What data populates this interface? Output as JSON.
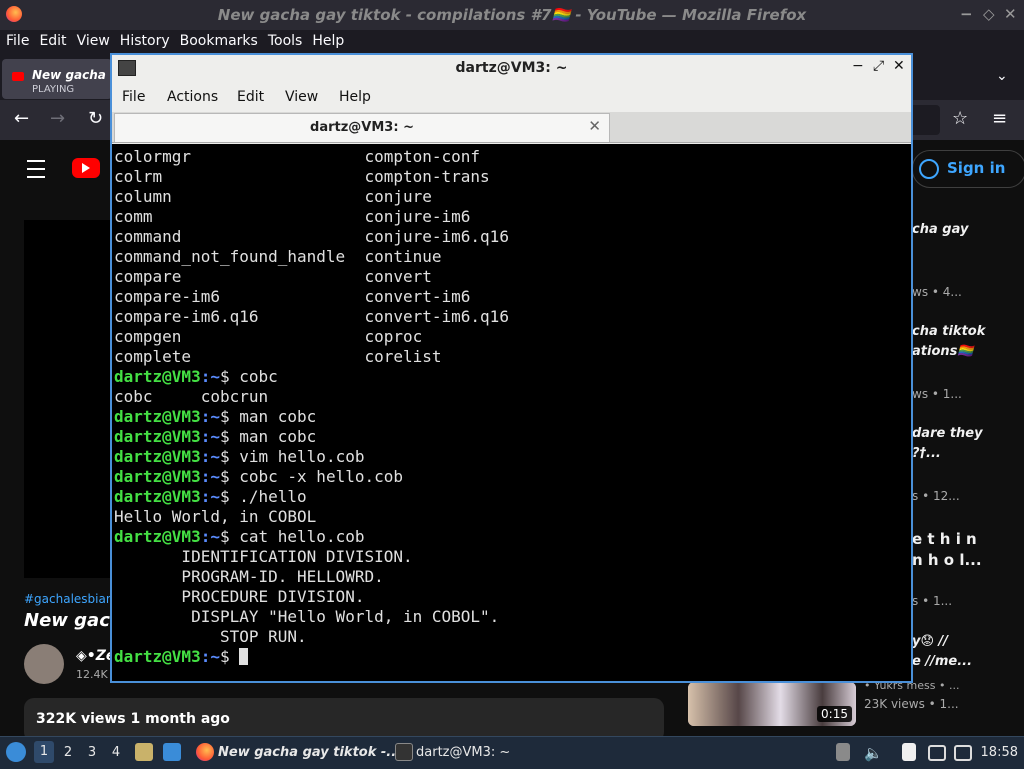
{
  "firefox": {
    "window_title": "New gacha gay tiktok - compilations #7🏳️‍🌈 - YouTube — Mozilla Firefox",
    "menu": [
      "File",
      "Edit",
      "View",
      "History",
      "Bookmarks",
      "Tools",
      "Help"
    ],
    "tab": {
      "title": "New gacha gay tiktok",
      "status": "PLAYING"
    }
  },
  "youtube": {
    "sign_in": "Sign in",
    "sidebar": [
      {
        "title": "cha gay",
        "meta": "ws • 4..."
      },
      {
        "title": "cha tiktok",
        "title2": "ations🏳️‍🌈",
        "meta": "ws • 1..."
      },
      {
        "title": "dare they",
        "title2": "?†...",
        "meta": "s • 12..."
      },
      {
        "title": "e t h i n",
        "title2": "n h o l...",
        "meta": "s • 1..."
      },
      {
        "title": "y😟 //",
        "title2": "e //me...",
        "meta": "• Yukrs mess • ...",
        "meta2": "23K views • 1..."
      }
    ],
    "hashtags": "#gachalesbian #",
    "video_title": "New gach",
    "channel": "◈•Ze",
    "subscribers": "12.4K",
    "views": "322K views  1 month ago",
    "thumb_duration": "0:15"
  },
  "terminal": {
    "title": "dartz@VM3: ~",
    "menu": [
      "File",
      "Actions",
      "Edit",
      "View",
      "Help"
    ],
    "tab_label": "dartz@VM3: ~",
    "prompt_user": "dartz@VM3",
    "prompt_path": ":~",
    "prompt_sym": "$",
    "completion_rows": [
      [
        "colormgr",
        "compton-conf"
      ],
      [
        "colrm",
        "compton-trans"
      ],
      [
        "column",
        "conjure"
      ],
      [
        "comm",
        "conjure-im6"
      ],
      [
        "command",
        "conjure-im6.q16"
      ],
      [
        "command_not_found_handle",
        "continue"
      ],
      [
        "compare",
        "convert"
      ],
      [
        "compare-im6",
        "convert-im6"
      ],
      [
        "compare-im6.q16",
        "convert-im6.q16"
      ],
      [
        "compgen",
        "coproc"
      ],
      [
        "complete",
        "corelist"
      ]
    ],
    "session": [
      {
        "type": "cmd",
        "text": " cobc"
      },
      {
        "type": "out",
        "text": "cobc     cobcrun"
      },
      {
        "type": "cmd",
        "text": " man cobc"
      },
      {
        "type": "cmd",
        "text": " man cobc"
      },
      {
        "type": "cmd",
        "text": " vim hello.cob"
      },
      {
        "type": "cmd",
        "text": " cobc -x hello.cob"
      },
      {
        "type": "cmd",
        "text": " ./hello"
      },
      {
        "type": "out",
        "text": "Hello World, in COBOL"
      },
      {
        "type": "cmd",
        "text": " cat hello.cob"
      },
      {
        "type": "out",
        "text": "       IDENTIFICATION DIVISION."
      },
      {
        "type": "out",
        "text": "       PROGRAM-ID. HELLOWRD."
      },
      {
        "type": "out",
        "text": "       PROCEDURE DIVISION."
      },
      {
        "type": "out",
        "text": "        DISPLAY \"Hello World, in COBOL\"."
      },
      {
        "type": "out",
        "text": "           STOP RUN."
      },
      {
        "type": "prompt",
        "text": " "
      }
    ]
  },
  "taskbar": {
    "workspaces": [
      "1",
      "2",
      "3",
      "4"
    ],
    "tasks": [
      {
        "label": "New gacha gay tiktok -..."
      },
      {
        "label": "dartz@VM3: ~"
      }
    ],
    "clock": "18:58"
  }
}
